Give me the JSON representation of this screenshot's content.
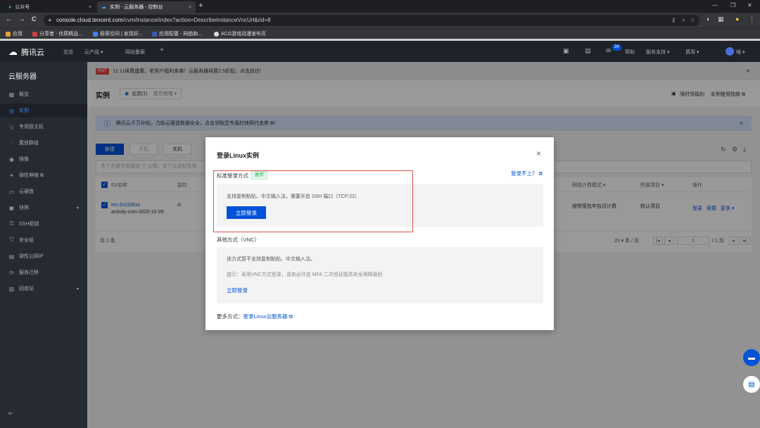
{
  "browser": {
    "tabs": [
      {
        "label": "公众号",
        "close": "×"
      },
      {
        "label": "实例 - 云服务器 - 控制台",
        "close": "×"
      }
    ],
    "new_tab": "+",
    "window": {
      "min": "—",
      "max": "❐",
      "close": "✕"
    },
    "nav": {
      "back": "←",
      "forward": "→",
      "reload": "C"
    },
    "url_host": "console.cloud.tencent.com",
    "url_path": "/cvm/instance/index?action=DescribeInstanceVncUrl&rid=8",
    "bookmarks": [
      "应用",
      "分享者 - 优质精品...",
      "极客空间 | 发现好...",
      "应用配置 - 网曲助...",
      "ACG游戏动漫发布页"
    ]
  },
  "topnav": {
    "logo": "腾讯云",
    "items": [
      "总览",
      "云产品 ▾",
      "网站备案",
      "+"
    ],
    "badge": "34",
    "right_items": [
      "帮助",
      "服务支持 ▾",
      "费用 ▾",
      "喵 ▾"
    ]
  },
  "sidebar": {
    "title": "云服务器",
    "items": [
      {
        "label": "概览",
        "icon": "grid-icon",
        "glyph": "▦"
      },
      {
        "label": "实例",
        "icon": "instance-icon",
        "glyph": "◎"
      },
      {
        "label": "专用宿主机",
        "icon": "host-icon",
        "glyph": "◇"
      },
      {
        "label": "置放群组",
        "icon": "group-icon",
        "glyph": "◌"
      },
      {
        "label": "镜像",
        "icon": "image-icon",
        "glyph": "◉"
      },
      {
        "label": "弹性伸缩 ⧉",
        "icon": "scaling-icon",
        "glyph": "✦"
      },
      {
        "label": "云硬盘",
        "icon": "disk-icon",
        "glyph": "▭"
      },
      {
        "label": "快照",
        "icon": "snapshot-icon",
        "glyph": "▣",
        "arrow": "▾"
      },
      {
        "label": "SSH密钥",
        "icon": "key-icon",
        "glyph": "⚿"
      },
      {
        "label": "安全组",
        "icon": "shield-icon",
        "glyph": "⛉"
      },
      {
        "label": "弹性公网IP",
        "icon": "ip-icon",
        "glyph": "▤"
      },
      {
        "label": "服务迁移",
        "icon": "migrate-icon",
        "glyph": "⟳"
      },
      {
        "label": "回收站",
        "icon": "trash-icon",
        "glyph": "▥",
        "arrow": "▾"
      }
    ],
    "collapse": "⇤"
  },
  "main": {
    "notice": {
      "hot": "HOT",
      "text": "11.11续费盛惠，老用户福利来袭！云服务器续费2.5折起，点击前往!",
      "close": "×"
    },
    "page_title": "实例",
    "region": {
      "label": "北京(1)",
      "other": "其它地域 ▾"
    },
    "right_links": [
      "限时领福利",
      "实例使用指南 ⧉"
    ],
    "info": {
      "text": "腾讯云千万补贴，力助云硬盘数据安全，点击领取您专属的快照代金券 ⧉！",
      "close": "×"
    },
    "toolbar": [
      "新建",
      "开机",
      "关机"
    ],
    "search_placeholder": "多个关键字用竖线 \"|\" 分隔，多个过滤标签用",
    "table": {
      "headers": [
        "ID/名称",
        "监控",
        "网络计费模式 ▾",
        "所属项目 ▾",
        "操作"
      ],
      "row": {
        "id": "ins-2n232kxx",
        "name": "activity-cvm-2020-10-26",
        "monitor": "ılı",
        "billing": "按带宽包年包月计费",
        "project": "默认项目",
        "ops": [
          "登录",
          "续费",
          "更多 ▾"
        ]
      }
    },
    "footer": {
      "total": "共 1 条",
      "page_size": "20 ▾ 条 / 页",
      "page": "1",
      "page_total": "/ 1 页"
    }
  },
  "modal": {
    "title": "登录Linux实例",
    "close": "×",
    "standard": {
      "title": "标准登录方式",
      "tag": "推荐",
      "desc": "支持复制粘贴、中文输入法，需要开启 SSH 端口（TCP:22）",
      "button": "立即登录"
    },
    "help": "登录不上？ ⧉",
    "other": {
      "title": "其他方式（VNC）",
      "desc": "该方式暂不支持复制粘贴、中文输入法。",
      "tip": "提示：采用VNC方式登录，请务必开启 MFA 二次验证提高安全保障级别",
      "link": "立即登录"
    },
    "more_label": "更多方式：",
    "more_link": "登录Linux云服务器 ⧉"
  },
  "colors": {
    "primary": "#0052d9",
    "highlight": "#e0524e"
  }
}
